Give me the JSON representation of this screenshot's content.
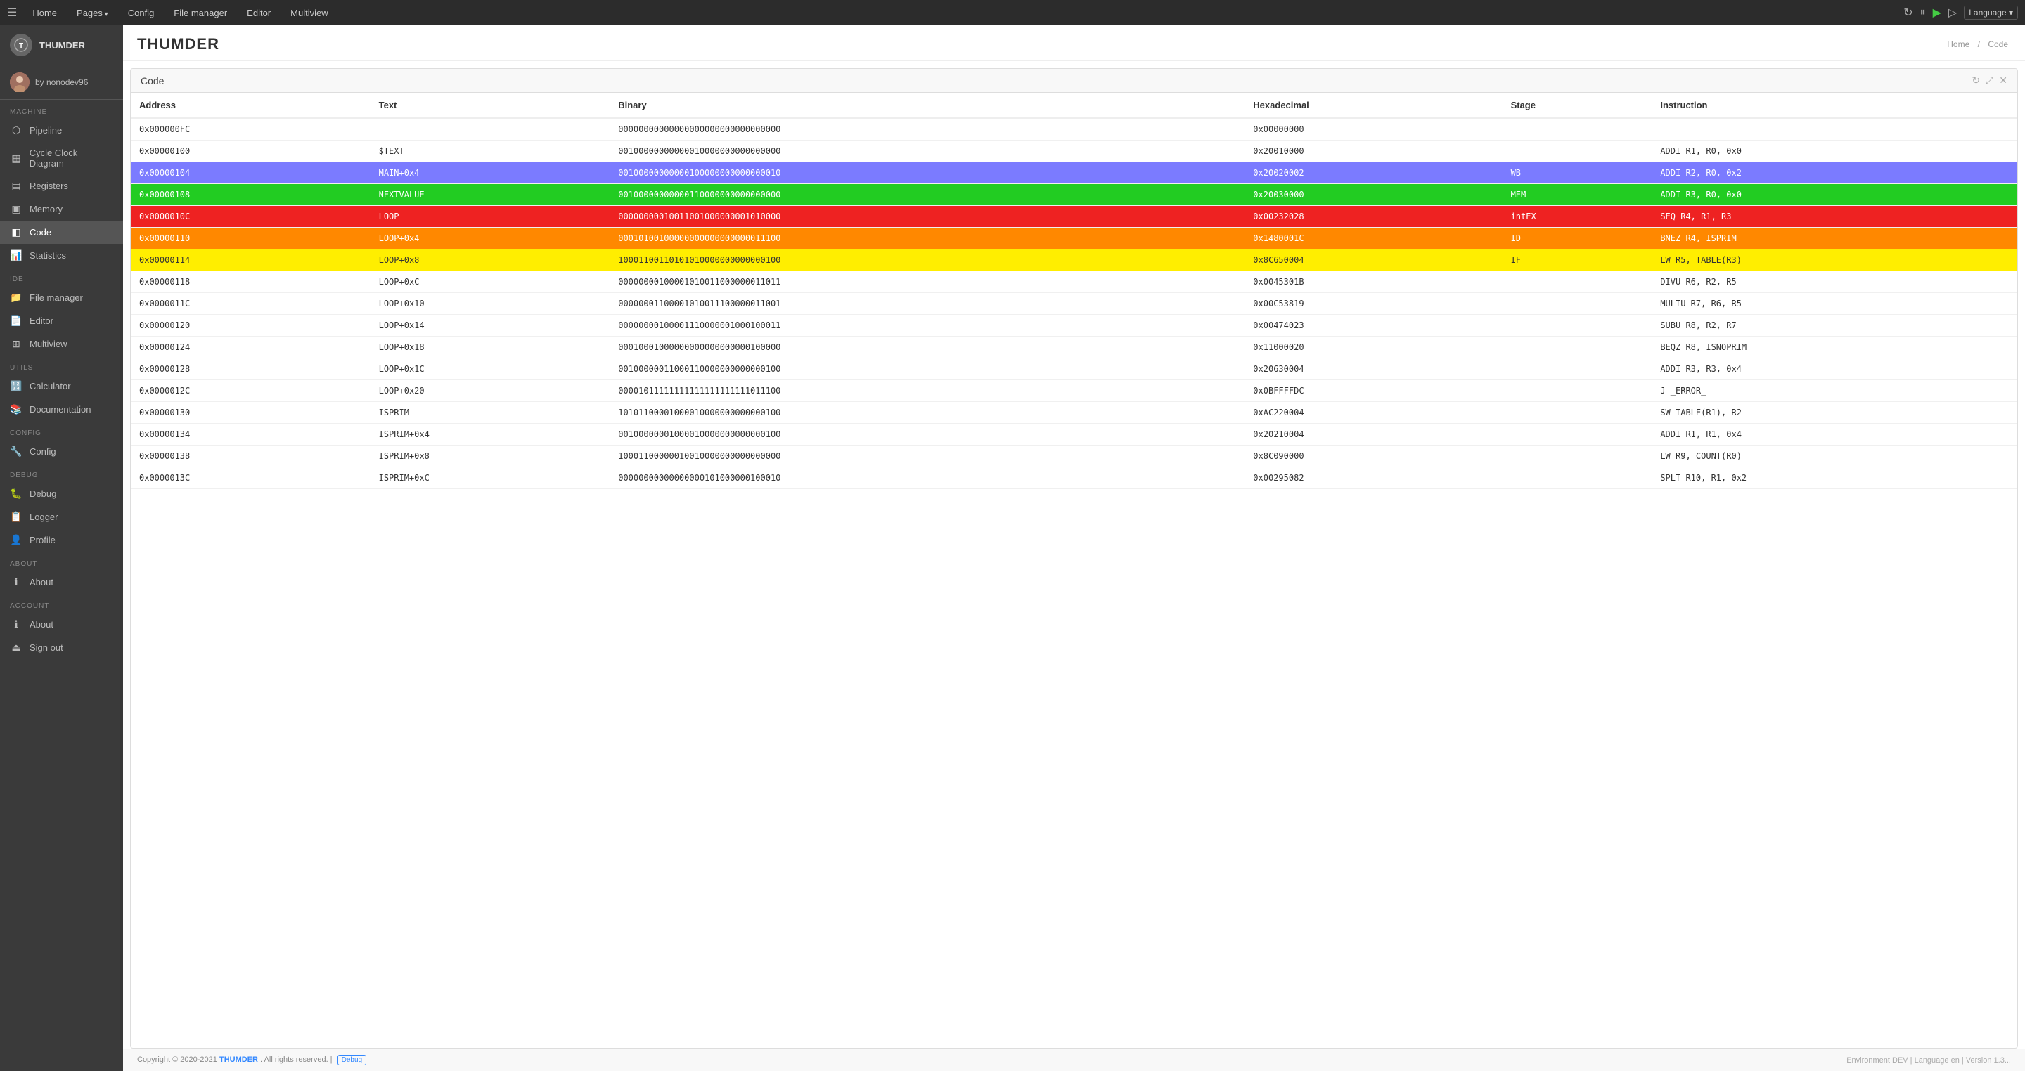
{
  "app": {
    "name": "THUMDER",
    "logo_initials": "T"
  },
  "topnav": {
    "hamburger": "☰",
    "items": [
      {
        "label": "Home",
        "dropdown": false
      },
      {
        "label": "Pages",
        "dropdown": true
      },
      {
        "label": "Config",
        "dropdown": false
      },
      {
        "label": "File manager",
        "dropdown": false
      },
      {
        "label": "Editor",
        "dropdown": false
      },
      {
        "label": "Multiview",
        "dropdown": false
      }
    ],
    "language_label": "Language ▾"
  },
  "sidebar": {
    "logo": "THUMDER",
    "user": {
      "display": "by nonodev96",
      "avatar": "👤"
    },
    "sections": [
      {
        "label": "Machine",
        "items": [
          {
            "id": "pipeline",
            "label": "Pipeline",
            "icon": "⬡"
          },
          {
            "id": "cycle-clock",
            "label": "Cycle Clock Diagram",
            "icon": "▦"
          },
          {
            "id": "registers",
            "label": "Registers",
            "icon": "▤"
          },
          {
            "id": "memory",
            "label": "Memory",
            "icon": "▣"
          },
          {
            "id": "code",
            "label": "Code",
            "icon": "◧",
            "active": true
          },
          {
            "id": "statistics",
            "label": "Statistics",
            "icon": "📊"
          }
        ]
      },
      {
        "label": "IDE",
        "items": [
          {
            "id": "file-manager",
            "label": "File manager",
            "icon": "📁"
          },
          {
            "id": "editor",
            "label": "Editor",
            "icon": "📄"
          },
          {
            "id": "multiview",
            "label": "Multiview",
            "icon": "⊞"
          }
        ]
      },
      {
        "label": "Utils",
        "items": [
          {
            "id": "calculator",
            "label": "Calculator",
            "icon": "🔢"
          },
          {
            "id": "documentation",
            "label": "Documentation",
            "icon": "📚"
          }
        ]
      },
      {
        "label": "Config",
        "items": [
          {
            "id": "config",
            "label": "Config",
            "icon": "🔧"
          }
        ]
      },
      {
        "label": "DEBUG",
        "items": [
          {
            "id": "debug",
            "label": "Debug",
            "icon": "🐛"
          },
          {
            "id": "logger",
            "label": "Logger",
            "icon": "📋"
          },
          {
            "id": "profile",
            "label": "Profile",
            "icon": "👤"
          }
        ]
      },
      {
        "label": "About",
        "items": [
          {
            "id": "about",
            "label": "About",
            "icon": "ℹ"
          }
        ]
      },
      {
        "label": "Account",
        "items": [
          {
            "id": "about2",
            "label": "About",
            "icon": "ℹ"
          },
          {
            "id": "signout",
            "label": "Sign out",
            "icon": "⏏"
          }
        ]
      }
    ]
  },
  "page": {
    "title": "THUMDER",
    "breadcrumb_home": "Home",
    "breadcrumb_sep": "/",
    "breadcrumb_current": "Code"
  },
  "code_panel": {
    "title": "Code",
    "columns": [
      "Address",
      "Text",
      "Binary",
      "Hexadecimal",
      "Stage",
      "Instruction"
    ],
    "rows": [
      {
        "address": "0x000000FC",
        "text": "",
        "binary": "00000000000000000000000000000000",
        "hex": "0x00000000",
        "stage": "",
        "instruction": "",
        "color": ""
      },
      {
        "address": "0x00000100",
        "text": "$TEXT",
        "binary": "00100000000000010000000000000000",
        "hex": "0x20010000",
        "stage": "",
        "instruction": "ADDI R1, R0, 0x0",
        "color": ""
      },
      {
        "address": "0x00000104",
        "text": "MAIN+0x4",
        "binary": "00100000000000100000000000000010",
        "hex": "0x20020002",
        "stage": "WB",
        "instruction": "ADDI R2, R0, 0x2",
        "color": "blue"
      },
      {
        "address": "0x00000108",
        "text": "NEXTVALUE",
        "binary": "00100000000000110000000000000000",
        "hex": "0x20030000",
        "stage": "MEM",
        "instruction": "ADDI R3, R0, 0x0",
        "color": "green"
      },
      {
        "address": "0x0000010C",
        "text": "LOOP",
        "binary": "00000000010011001000000001010000",
        "hex": "0x00232028",
        "stage": "intEX",
        "instruction": "SEQ R4, R1, R3",
        "color": "red"
      },
      {
        "address": "0x00000110",
        "text": "LOOP+0x4",
        "binary": "00010100100000000000000000011100",
        "hex": "0x1480001C",
        "stage": "ID",
        "instruction": "BNEZ R4, ISPRIM",
        "color": "orange"
      },
      {
        "address": "0x00000114",
        "text": "LOOP+0x8",
        "binary": "10001100110101010000000000000100",
        "hex": "0x8C650004",
        "stage": "IF",
        "instruction": "LW R5, TABLE(R3)",
        "color": "yellow"
      },
      {
        "address": "0x00000118",
        "text": "LOOP+0xC",
        "binary": "00000000100001010011000000011011",
        "hex": "0x0045301B",
        "stage": "",
        "instruction": "DIVU R6, R2, R5",
        "color": ""
      },
      {
        "address": "0x0000011C",
        "text": "LOOP+0x10",
        "binary": "00000001100001010011100000011001",
        "hex": "0x00C53819",
        "stage": "",
        "instruction": "MULTU R7, R6, R5",
        "color": ""
      },
      {
        "address": "0x00000120",
        "text": "LOOP+0x14",
        "binary": "00000000100001110000001000100011",
        "hex": "0x00474023",
        "stage": "",
        "instruction": "SUBU R8, R2, R7",
        "color": ""
      },
      {
        "address": "0x00000124",
        "text": "LOOP+0x18",
        "binary": "00010001000000000000000000100000",
        "hex": "0x11000020",
        "stage": "",
        "instruction": "BEQZ R8, ISNOPRIM",
        "color": ""
      },
      {
        "address": "0x00000128",
        "text": "LOOP+0x1C",
        "binary": "00100000011000110000000000000100",
        "hex": "0x20630004",
        "stage": "",
        "instruction": "ADDI R3, R3, 0x4",
        "color": ""
      },
      {
        "address": "0x0000012C",
        "text": "LOOP+0x20",
        "binary": "00001011111111111111111111011100",
        "hex": "0x0BFFFFDC",
        "stage": "",
        "instruction": "J _ERROR_",
        "color": ""
      },
      {
        "address": "0x00000130",
        "text": "ISPRIM",
        "binary": "10101100001000010000000000000100",
        "hex": "0xAC220004",
        "stage": "",
        "instruction": "SW TABLE(R1), R2",
        "color": ""
      },
      {
        "address": "0x00000134",
        "text": "ISPRIM+0x4",
        "binary": "00100000001000010000000000000100",
        "hex": "0x20210004",
        "stage": "",
        "instruction": "ADDI R1, R1, 0x4",
        "color": ""
      },
      {
        "address": "0x00000138",
        "text": "ISPRIM+0x8",
        "binary": "10001100000010010000000000000000",
        "hex": "0x8C090000",
        "stage": "",
        "instruction": "LW R9, COUNT(R0)",
        "color": ""
      },
      {
        "address": "0x0000013C",
        "text": "ISPRIM+0xC",
        "binary": "00000000000000000101000000100010",
        "hex": "0x00295082",
        "stage": "",
        "instruction": "SPLT R10, R1, 0x2",
        "color": ""
      }
    ]
  },
  "footer": {
    "copyright": "Copyright © 2020-2021",
    "brand": "THUMDER",
    "rights": ". All rights reserved. |",
    "badge": "Debug",
    "environment": "Environment DEV | Language en | Version 1.3..."
  }
}
